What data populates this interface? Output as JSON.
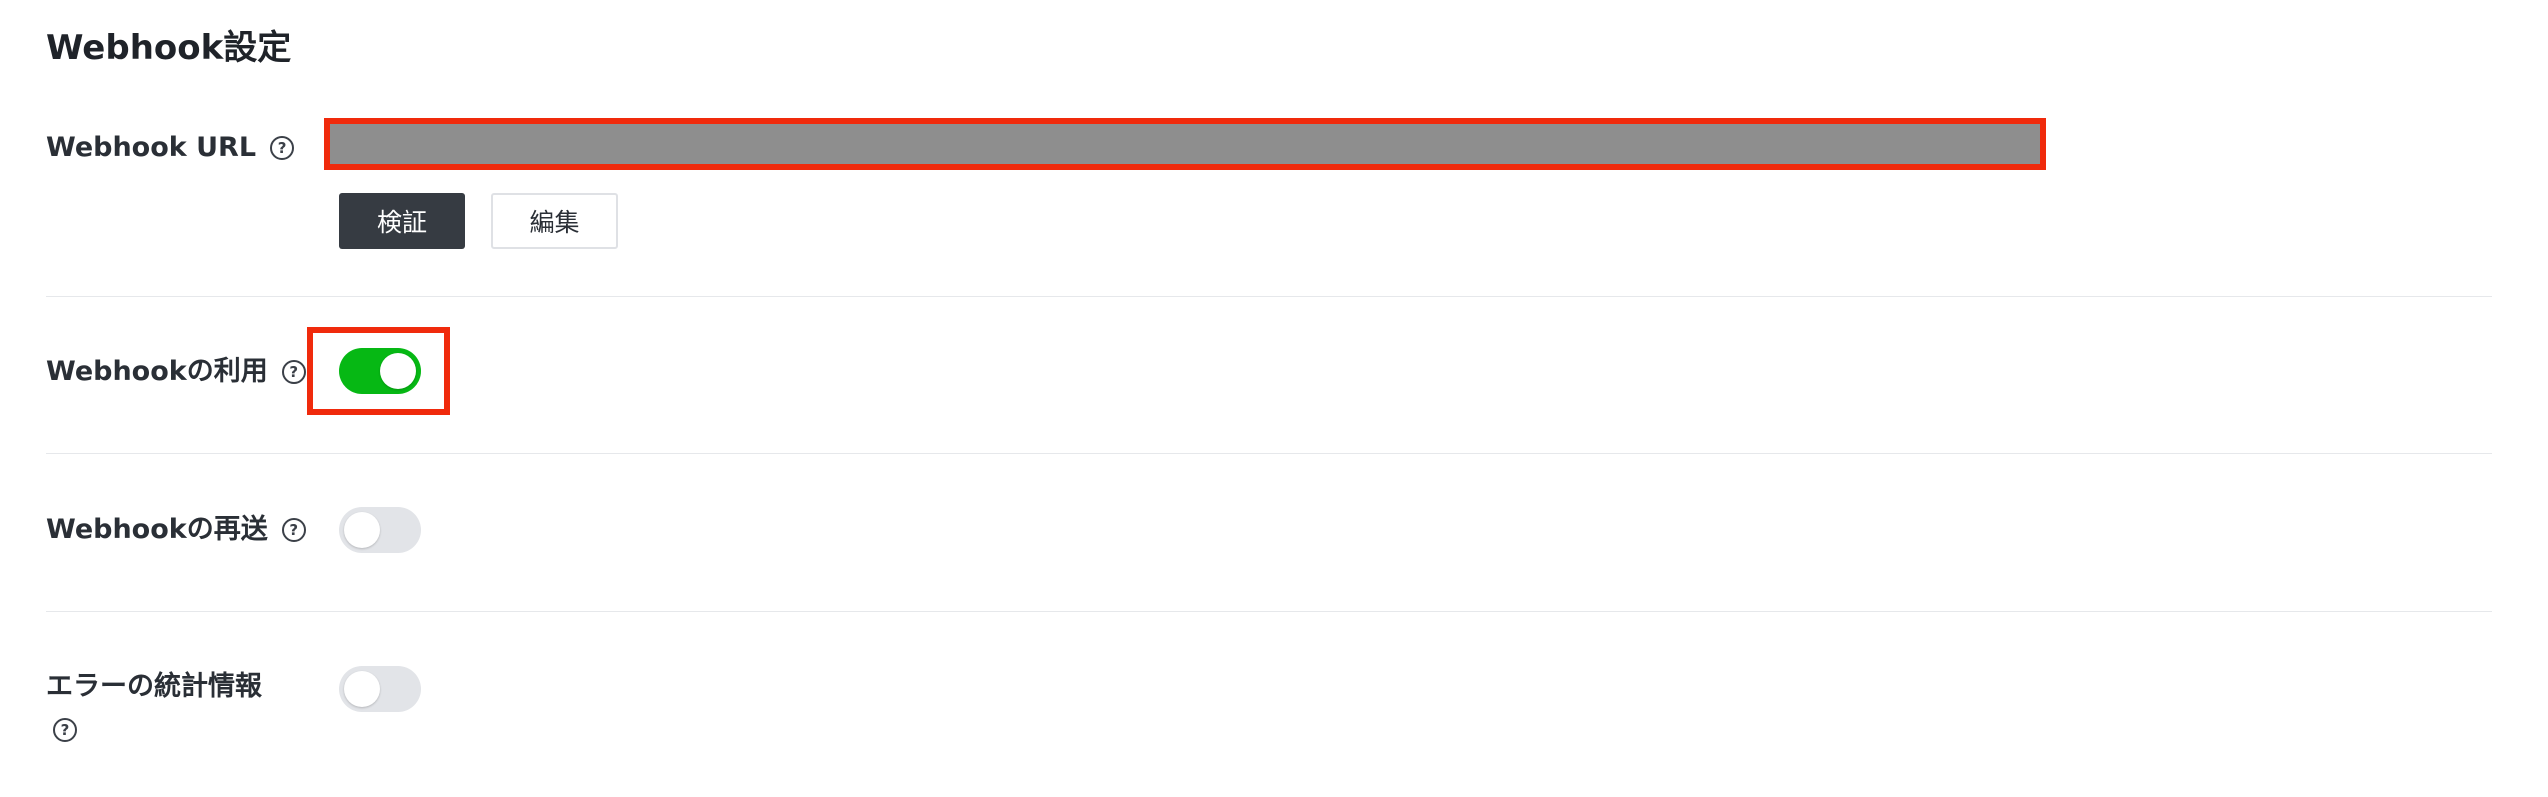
{
  "section": {
    "title": "Webhook設定"
  },
  "webhook_url": {
    "label": "Webhook URL",
    "help_icon": "question-circle-icon",
    "value_redacted": true,
    "verify_button": "検証",
    "edit_button": "編集"
  },
  "use_webhook": {
    "label": "Webhookの利用",
    "help_icon": "question-circle-icon",
    "enabled": true
  },
  "redelivery": {
    "label": "Webhookの再送",
    "help_icon": "question-circle-icon",
    "enabled": false
  },
  "error_stats": {
    "label": "エラーの統計情報",
    "help_icon": "question-circle-icon",
    "enabled": false
  },
  "help_glyph": "?",
  "colors": {
    "toggle_on": "#06b814",
    "toggle_off": "#e2e4e8",
    "highlight": "#f02a0c",
    "primary_button": "#363b42",
    "redacted_field": "#8e8e8e"
  }
}
